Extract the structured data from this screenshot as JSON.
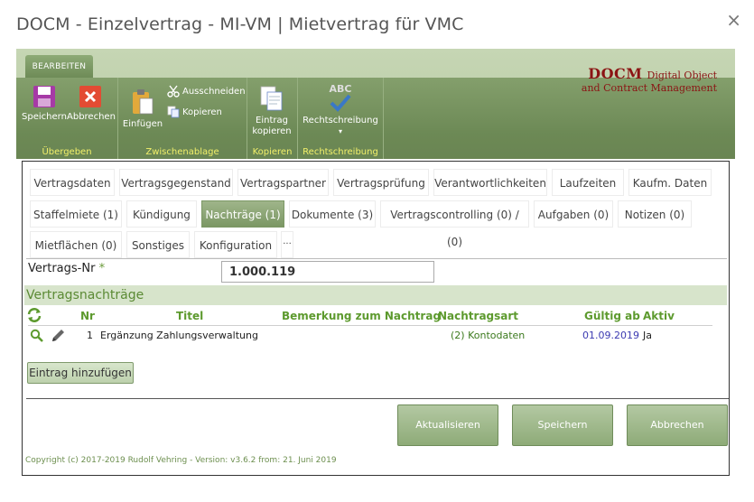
{
  "dialog": {
    "title": "DOCM - Einzelvertrag - MI-VM | Mietvertrag für VMC",
    "close_glyph": "×"
  },
  "ribbon": {
    "tab_label": "BEARBEITEN",
    "groups": {
      "uebergeben": {
        "label": "Übergeben",
        "save": "Speichern",
        "cancel": "Abbrechen"
      },
      "zwischenablage": {
        "label": "Zwischenablage",
        "paste": "Einfügen",
        "cut": "Ausschneiden",
        "copy": "Kopieren"
      },
      "kopieren": {
        "label": "Kopieren",
        "entry_copy_1": "Eintrag",
        "entry_copy_2": "kopieren"
      },
      "rechtschreibung": {
        "label": "Rechtschreibung",
        "spelling": "Rechtschreibung",
        "spelling_dropdown": "▾",
        "abc": "ABC"
      }
    },
    "logo": {
      "line1_bold": "DOCM",
      "line1_rest": "Digital Object",
      "line2": "and Contract Management"
    },
    "colors": {
      "accent": "#6c8955",
      "group_label": "#f2f06a",
      "logo": "#8b1414"
    }
  },
  "tabs": {
    "row1": [
      "Vertragsdaten",
      "Vertragsgegenstand",
      "Vertragspartner",
      "Vertragsprüfung",
      "Verantwortlichkeiten",
      "Laufzeiten",
      "Kaufm. Daten"
    ],
    "row2": [
      "Staffelmiete (1)",
      "Kündigung",
      "Nachträge (1)",
      "Dokumente (3)",
      "Vertragscontrolling (0) / (0)",
      "Aufgaben (0)",
      "Notizen (0)"
    ],
    "row3": [
      "Mietflächen (0)",
      "Sonstiges",
      "Konfiguration",
      "..."
    ],
    "active": "Nachträge (1)"
  },
  "form": {
    "vertrags_nr_label": "Vertrags-Nr",
    "required_mark": "*",
    "vertrags_nr_value": "1.000.119"
  },
  "section": {
    "title": "Vertragsnachträge",
    "columns": [
      "Nr",
      "Titel",
      "Bemerkung zum Nachtrag",
      "Nachtragsart",
      "Gültig ab",
      "Aktiv"
    ],
    "rows": [
      {
        "nr": "1",
        "titel": "Ergänzung Zahlungsverwaltung",
        "bemerkung": "",
        "art": "(2) Kontodaten",
        "gueltig_ab": "01.09.2019",
        "aktiv": "Ja"
      }
    ],
    "add_button": "Eintrag hinzufügen"
  },
  "actions": {
    "refresh": "Aktualisieren",
    "save": "Speichern",
    "cancel": "Abbrechen"
  },
  "footer": {
    "copyright": "Copyright (c) 2017-2019 Rudolf Vehring - Version: v3.6.2 from: 21. Juni 2019"
  }
}
